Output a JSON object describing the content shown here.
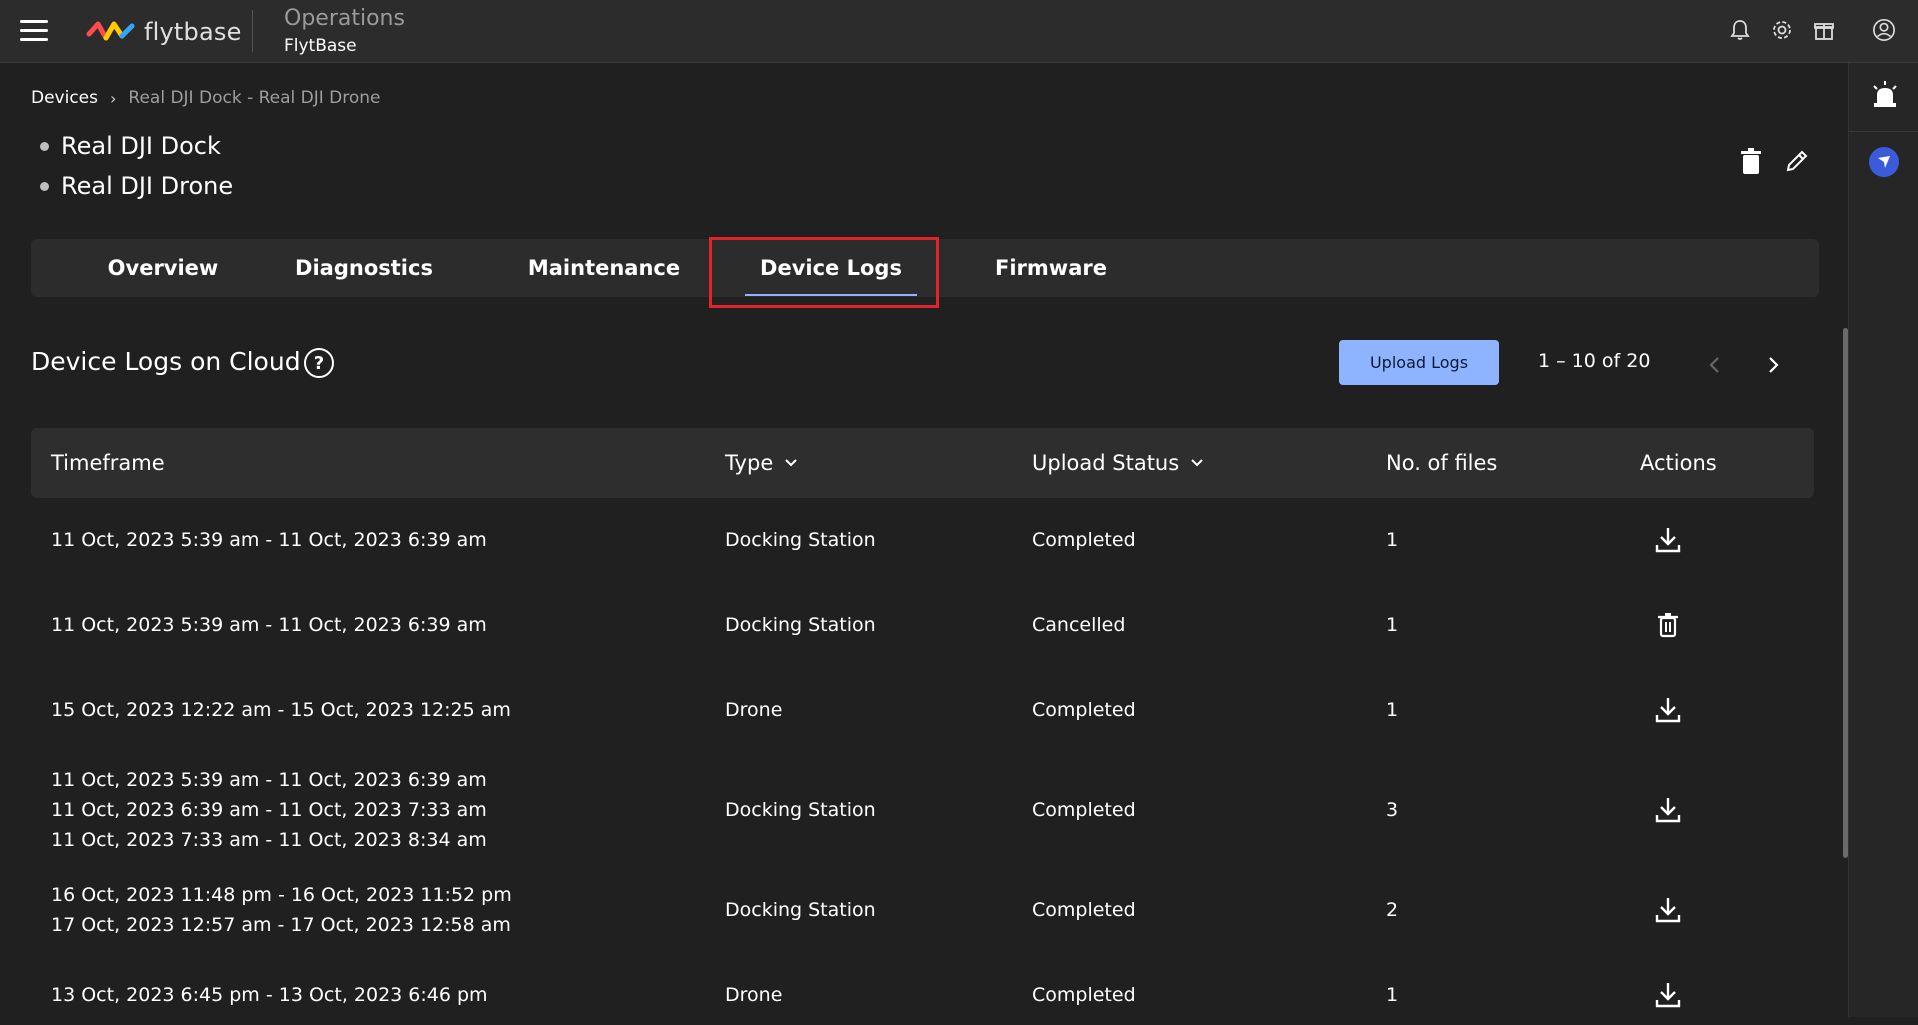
{
  "header": {
    "logo_text": "flytbase",
    "app_title": "Operations",
    "org_name": "FlytBase"
  },
  "breadcrumb": {
    "root": "Devices",
    "separator": "›",
    "current": "Real DJI Dock - Real DJI Drone"
  },
  "devices": [
    "Real DJI Dock",
    "Real DJI Drone"
  ],
  "tabs": [
    {
      "label": "Overview"
    },
    {
      "label": "Diagnostics"
    },
    {
      "label": "Maintenance"
    },
    {
      "label": "Device Logs",
      "active": true
    },
    {
      "label": "Firmware"
    }
  ],
  "section": {
    "title": "Device Logs on Cloud",
    "help": "?",
    "upload_label": "Upload Logs",
    "pagination": "1 – 10 of 20"
  },
  "table": {
    "headers": {
      "timeframe": "Timeframe",
      "type": "Type",
      "status": "Upload Status",
      "files": "No. of files",
      "actions": "Actions"
    },
    "rows": [
      {
        "timeframes": [
          "11 Oct, 2023 5:39 am - 11 Oct, 2023 6:39 am"
        ],
        "type": "Docking Station",
        "status": "Completed",
        "files": "1",
        "action": "download-icon"
      },
      {
        "timeframes": [
          "11 Oct, 2023 5:39 am - 11 Oct, 2023 6:39 am"
        ],
        "type": "Docking Station",
        "status": "Cancelled",
        "files": "1",
        "action": "delete-icon"
      },
      {
        "timeframes": [
          "15 Oct, 2023 12:22 am - 15 Oct, 2023 12:25 am"
        ],
        "type": "Drone",
        "status": "Completed",
        "files": "1",
        "action": "download-icon"
      },
      {
        "timeframes": [
          "11 Oct, 2023 5:39 am - 11 Oct, 2023 6:39 am",
          "11 Oct, 2023 6:39 am - 11 Oct, 2023 7:33 am",
          "11 Oct, 2023 7:33 am - 11 Oct, 2023 8:34 am"
        ],
        "type": "Docking Station",
        "status": "Completed",
        "files": "3",
        "action": "download-icon"
      },
      {
        "timeframes": [
          "16 Oct, 2023 11:48 pm - 16 Oct, 2023 11:52 pm",
          "17 Oct, 2023 12:57 am - 17 Oct, 2023 12:58 am"
        ],
        "type": "Docking Station",
        "status": "Completed",
        "files": "2",
        "action": "download-icon"
      },
      {
        "timeframes": [
          "13 Oct, 2023 6:45 pm - 13 Oct, 2023 6:46 pm"
        ],
        "type": "Drone",
        "status": "Completed",
        "files": "1",
        "action": "download-icon"
      }
    ]
  },
  "colors": {
    "background": "#202020",
    "accent": "#8fb4ff",
    "highlight": "#e0242a"
  }
}
